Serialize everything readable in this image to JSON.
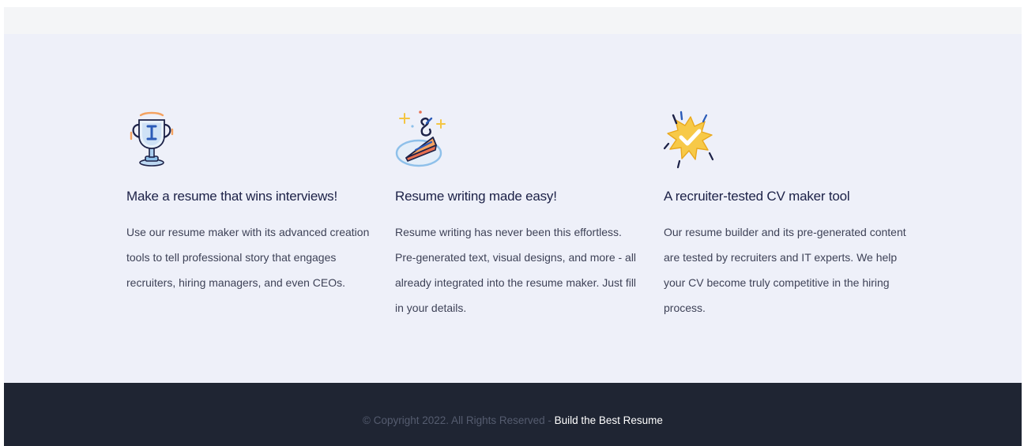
{
  "features": [
    {
      "icon": "trophy-icon",
      "title": "Make a resume that wins interviews!",
      "text": "Use our resume maker with its advanced creation tools to tell professional story that engages recruiters, hiring managers, and even CEOs."
    },
    {
      "icon": "pie-slice-sparkle-icon",
      "title": "Resume writing made easy!",
      "text": "Resume writing has never been this effortless. Pre-generated text, visual designs, and more - all already integrated into the resume maker. Just fill in your details."
    },
    {
      "icon": "badge-check-icon",
      "title": "A recruiter-tested CV maker tool",
      "text": "Our resume builder and its pre-generated content are tested by recruiters and IT experts. We help your CV become truly competitive in the hiring process."
    }
  ],
  "footer": {
    "copyright": "© Copyright 2022. All Rights Reserved - ",
    "link_label": "Build the Best Resume"
  },
  "colors": {
    "band_bg": "#eef0f9",
    "footer_bg": "#1f2533",
    "heading": "#1c2147",
    "body_text": "#3e4257",
    "footer_muted": "#555c6f"
  }
}
